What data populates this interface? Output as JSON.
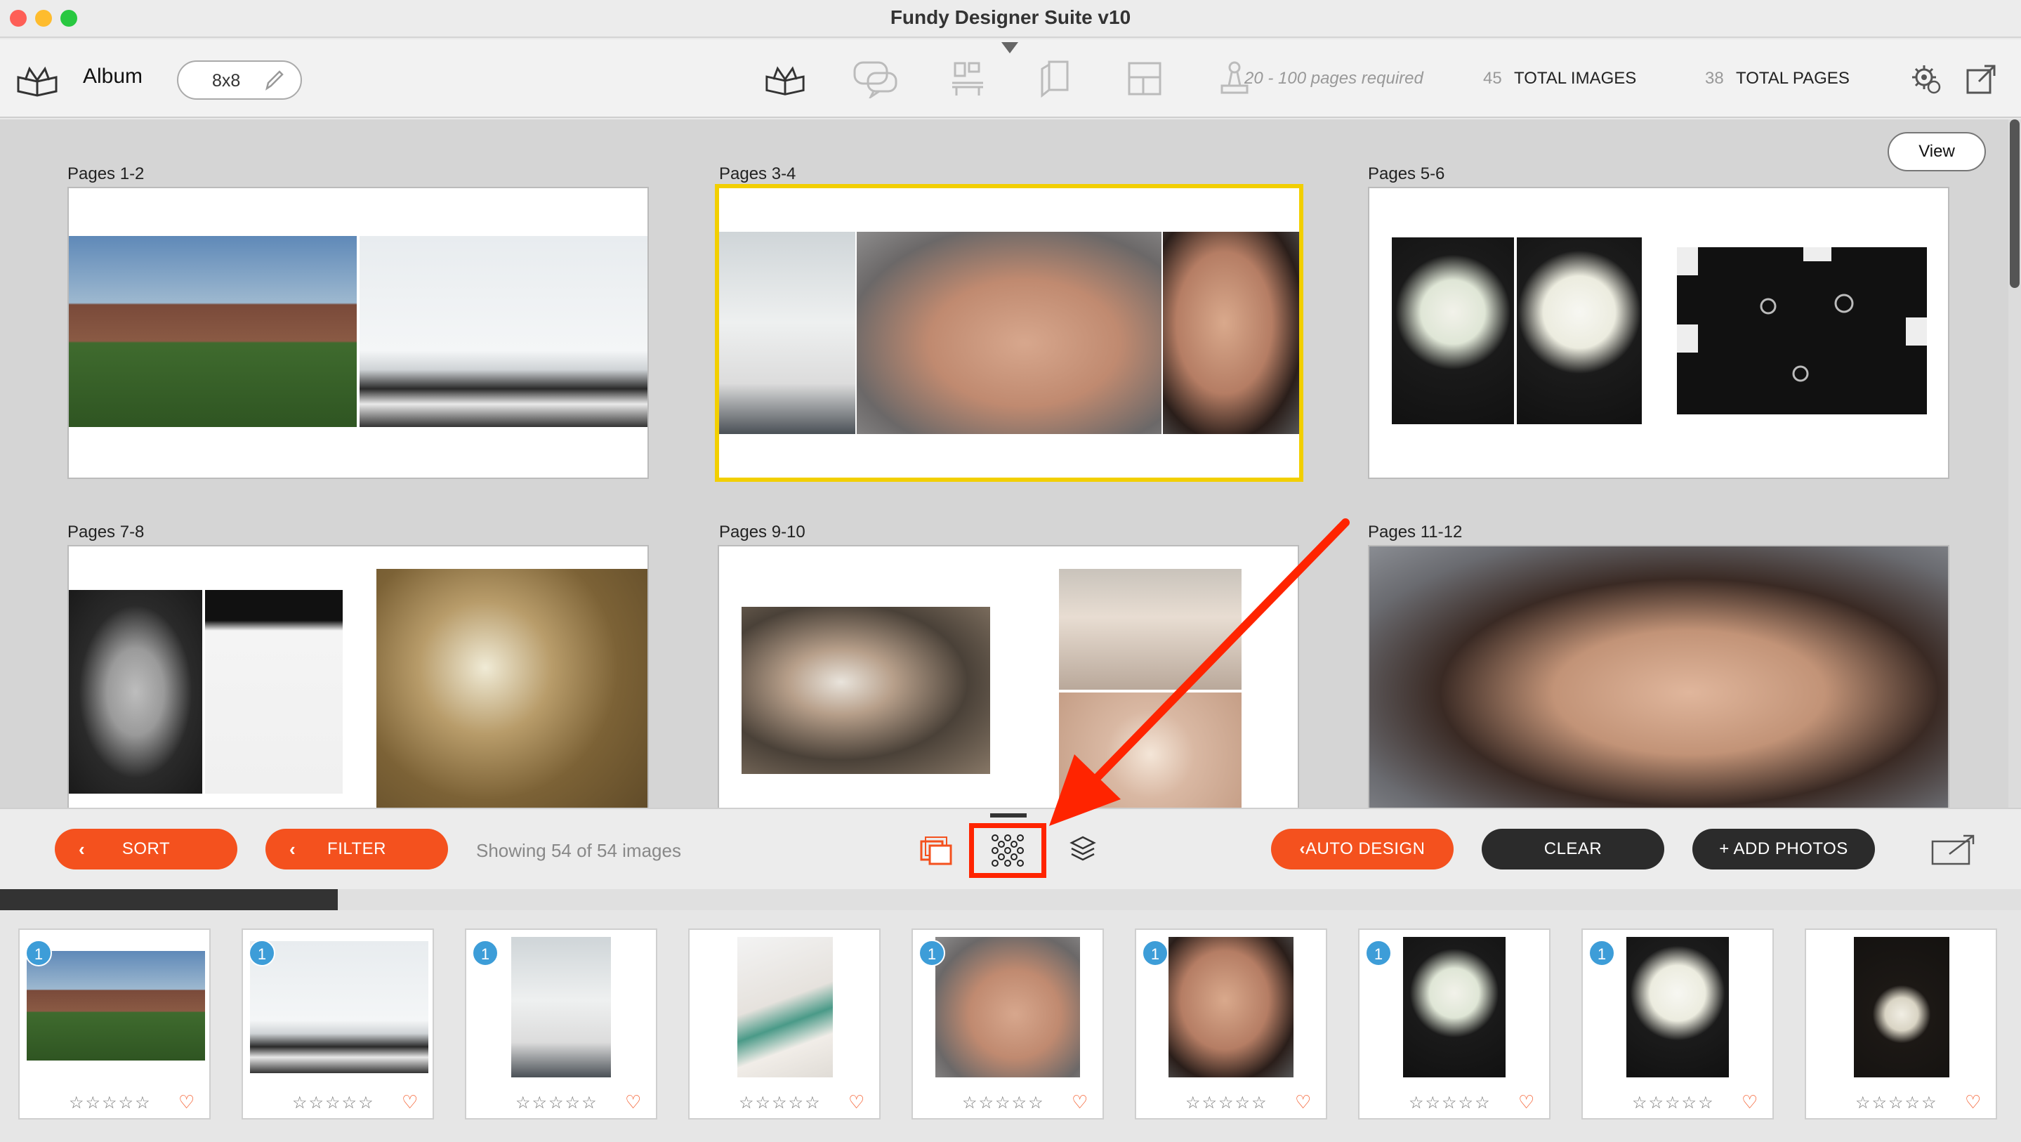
{
  "window": {
    "title": "Fundy Designer Suite v10"
  },
  "toolbar": {
    "album_label": "Album",
    "size_value": "8x8",
    "pages_required": "20 - 100 pages required",
    "total_images_count": "45",
    "total_images_label": "TOTAL IMAGES",
    "total_pages_count": "38",
    "total_pages_label": "TOTAL PAGES"
  },
  "canvas": {
    "view_button": "View",
    "spreads": [
      {
        "label": "Pages 1-2",
        "selected": false
      },
      {
        "label": "Pages 3-4",
        "selected": true
      },
      {
        "label": "Pages 5-6",
        "selected": false
      },
      {
        "label": "Pages 7-8",
        "selected": false
      },
      {
        "label": "Pages 9-10",
        "selected": false
      },
      {
        "label": "Pages 11-12",
        "selected": false
      }
    ]
  },
  "bottombar": {
    "sort_label": "SORT",
    "filter_label": "FILTER",
    "showing_text": "Showing 54 of 54 images",
    "auto_design_label": "AUTO DESIGN",
    "clear_label": "CLEAR",
    "add_photos_label": "+ ADD PHOTOS",
    "sort_chevron": "‹",
    "filter_chevron": "‹",
    "auto_chevron": "‹"
  },
  "filmstrip": {
    "progress": 0.167,
    "thumbnails": [
      {
        "badge": "1",
        "subject": "garden-estate"
      },
      {
        "badge": "1",
        "subject": "couple-in-window-room"
      },
      {
        "badge": "1",
        "subject": "wedding-dress-hanging"
      },
      {
        "badge": "",
        "subject": "writing-letter"
      },
      {
        "badge": "1",
        "subject": "bride-earring-closeup"
      },
      {
        "badge": "1",
        "subject": "bride-smiling"
      },
      {
        "badge": "1",
        "subject": "bouquet-vase"
      },
      {
        "badge": "1",
        "subject": "white-bouquet"
      },
      {
        "badge": "",
        "subject": "small-bouquet"
      }
    ],
    "stars": "☆☆☆☆☆",
    "heart": "♡"
  },
  "colors": {
    "accent_orange": "#f4511e",
    "selection_yellow": "#f2cf00",
    "annotation_red": "#ff2400",
    "badge_blue": "#3d9dd8"
  }
}
